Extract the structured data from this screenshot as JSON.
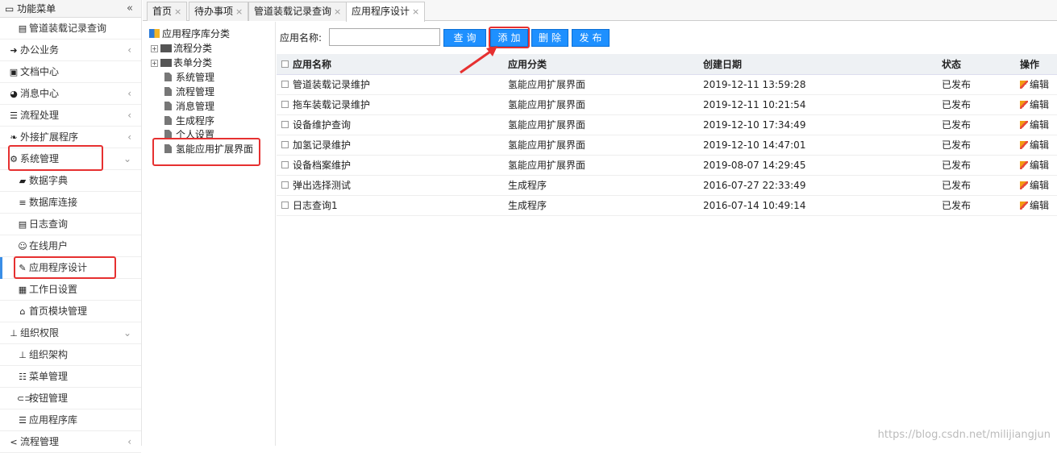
{
  "sidebar": {
    "title": "功能菜单",
    "collapse_glyph": "«",
    "items": [
      {
        "label": "管道装载记录查询",
        "icon": "file-icon",
        "level": "sub"
      },
      {
        "label": "办公业务",
        "icon": "signin-icon",
        "level": "top",
        "chevron": "left"
      },
      {
        "label": "文档中心",
        "icon": "word-doc-icon",
        "level": "top"
      },
      {
        "label": "消息中心",
        "icon": "wechat-icon",
        "level": "top",
        "chevron": "left"
      },
      {
        "label": "流程处理",
        "icon": "list-icon",
        "level": "top",
        "chevron": "left"
      },
      {
        "label": "外接扩展程序",
        "icon": "leaf-icon",
        "level": "top",
        "chevron": "left"
      },
      {
        "label": "系统管理",
        "icon": "gear-icon",
        "level": "top",
        "chevron": "down"
      },
      {
        "label": "数据字典",
        "icon": "book-icon",
        "level": "sub"
      },
      {
        "label": "数据库连接",
        "icon": "database-icon",
        "level": "sub"
      },
      {
        "label": "日志查询",
        "icon": "file-text-icon",
        "level": "sub"
      },
      {
        "label": "在线用户",
        "icon": "user-icon",
        "level": "sub"
      },
      {
        "label": "应用程序设计",
        "icon": "edit-icon",
        "level": "sub",
        "active": true
      },
      {
        "label": "工作日设置",
        "icon": "calendar-icon",
        "level": "sub"
      },
      {
        "label": "首页模块管理",
        "icon": "home-icon",
        "level": "sub"
      },
      {
        "label": "组织权限",
        "icon": "sitemap-icon",
        "level": "top",
        "chevron": "down"
      },
      {
        "label": "组织架构",
        "icon": "sitemap-icon",
        "level": "sub"
      },
      {
        "label": "菜单管理",
        "icon": "th-list-icon",
        "level": "sub"
      },
      {
        "label": "按钮管理",
        "icon": "toggle-icon",
        "level": "sub"
      },
      {
        "label": "应用程序库",
        "icon": "list-ul-icon",
        "level": "sub"
      },
      {
        "label": "流程管理",
        "icon": "share-icon",
        "level": "top",
        "chevron": "left"
      }
    ]
  },
  "tabs": [
    {
      "label": "首页",
      "close": "×"
    },
    {
      "label": "待办事项",
      "close": "×"
    },
    {
      "label": "管道装载记录查询",
      "close": "×"
    },
    {
      "label": "应用程序设计",
      "close": "×",
      "active": true
    }
  ],
  "tree": {
    "root": "应用程序库分类",
    "nodes": [
      {
        "label": "流程分类",
        "type": "folder",
        "expander": "+"
      },
      {
        "label": "表单分类",
        "type": "folder",
        "expander": "+"
      },
      {
        "label": "系统管理",
        "type": "doc"
      },
      {
        "label": "流程管理",
        "type": "doc"
      },
      {
        "label": "消息管理",
        "type": "doc"
      },
      {
        "label": "生成程序",
        "type": "doc"
      },
      {
        "label": "个人设置",
        "type": "doc"
      },
      {
        "label": "氢能应用扩展界面",
        "type": "doc"
      }
    ]
  },
  "search": {
    "label": "应用名称:",
    "value": "",
    "placeholder": "",
    "buttons": {
      "query": "查询",
      "add": "添加",
      "delete": "删除",
      "publish": "发布"
    }
  },
  "grid": {
    "columns": [
      "应用名称",
      "应用分类",
      "创建日期",
      "状态",
      "操作"
    ],
    "rows": [
      {
        "name": "管道装载记录维护",
        "category": "氢能应用扩展界面",
        "date": "2019-12-11 13:59:28",
        "status": "已发布",
        "action": "编辑"
      },
      {
        "name": "拖车装载记录维护",
        "category": "氢能应用扩展界面",
        "date": "2019-12-11 10:21:54",
        "status": "已发布",
        "action": "编辑"
      },
      {
        "name": "设备维护查询",
        "category": "氢能应用扩展界面",
        "date": "2019-12-10 17:34:49",
        "status": "已发布",
        "action": "编辑"
      },
      {
        "name": "加氢记录维护",
        "category": "氢能应用扩展界面",
        "date": "2019-12-10 14:47:01",
        "status": "已发布",
        "action": "编辑"
      },
      {
        "name": "设备档案维护",
        "category": "氢能应用扩展界面",
        "date": "2019-08-07 14:29:45",
        "status": "已发布",
        "action": "编辑"
      },
      {
        "name": "弹出选择测试",
        "category": "生成程序",
        "date": "2016-07-27 22:33:49",
        "status": "已发布",
        "action": "编辑"
      },
      {
        "name": "日志查询1",
        "category": "生成程序",
        "date": "2016-07-14 10:49:14",
        "status": "已发布",
        "action": "编辑"
      }
    ]
  },
  "watermark": "https://blog.csdn.net/milijiangjun",
  "colors": {
    "accent": "#1e90ff",
    "highlight": "#e63030"
  }
}
